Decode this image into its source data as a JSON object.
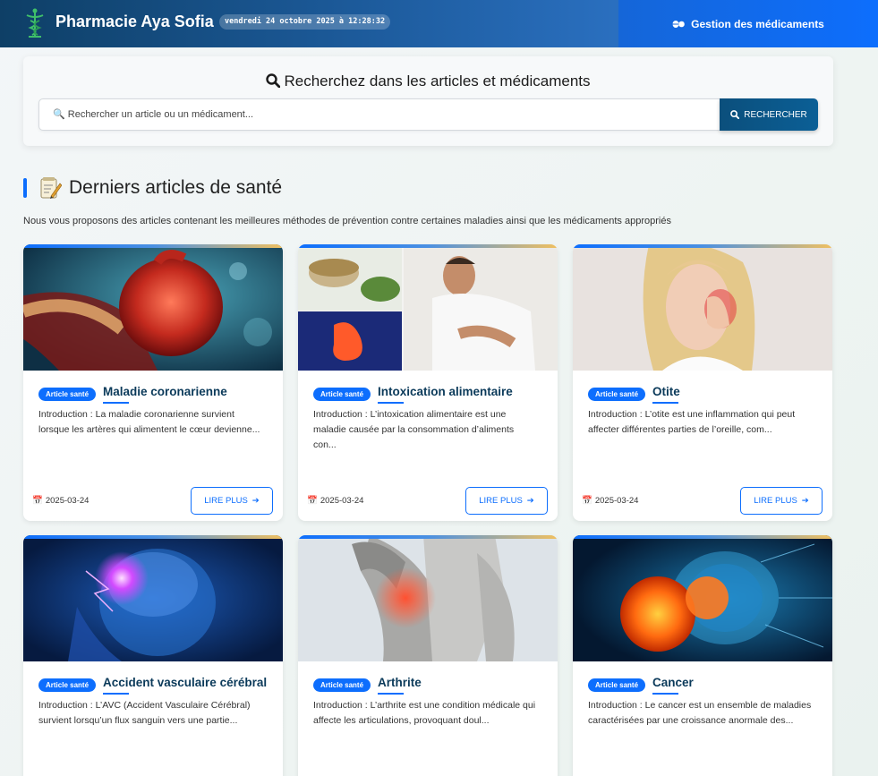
{
  "header": {
    "brand": "Pharmacie Aya Sofia",
    "datetime": "vendredi 24 octobre 2025 à 12:28:32",
    "nav_label": "Gestion des médicaments",
    "logo_icon": "caduceus-icon",
    "nav_icon": "pills-icon"
  },
  "search": {
    "title": "Recherchez dans les articles et médicaments",
    "placeholder": "🔍 Rechercher un article ou un médicament...",
    "button_label": "RECHERCHER"
  },
  "section": {
    "title": "Derniers articles de santé",
    "subtitle": "Nous vous proposons des articles contenant les meilleures méthodes de prévention contre certaines maladies ainsi que les médicaments appropriés"
  },
  "colors": {
    "primary": "#0d6efd",
    "header_dark": "#0e3f66",
    "title_text": "#0b3a5a"
  },
  "articles": [
    {
      "badge": "Article santé",
      "title": "Maladie coronarienne",
      "intro": "Introduction : La maladie coronarienne survient lorsque les artères qui alimentent le cœur devienne...",
      "date": "2025-03-24",
      "more": "LIRE PLUS",
      "image": "heart-artery-illustration"
    },
    {
      "badge": "Article santé",
      "title": "Intoxication alimentaire",
      "intro": "Introduction : L’intoxication alimentaire est une maladie causée par la consommation d’aliments con...",
      "date": "2025-03-24",
      "more": "LIRE PLUS",
      "image": "stomach-pain-collage"
    },
    {
      "badge": "Article santé",
      "title": "Otite",
      "intro": "Introduction : L’otite est une inflammation qui peut affecter différentes parties de l’oreille, com...",
      "date": "2025-03-24",
      "more": "LIRE PLUS",
      "image": "ear-pain-photo"
    },
    {
      "badge": "Article santé",
      "title": "Accident vasculaire cérébral",
      "intro": "Introduction : L’AVC (Accident Vasculaire Cérébral) survient lorsqu’un flux sanguin vers une partie...",
      "date": "",
      "more": "",
      "image": "brain-glow-illustration"
    },
    {
      "badge": "Article santé",
      "title": "Arthrite",
      "intro": "Introduction : L’arthrite est une condition médicale qui affecte les articulations, provoquant doul...",
      "date": "",
      "more": "",
      "image": "knee-pain-photo"
    },
    {
      "badge": "Article santé",
      "title": "Cancer",
      "intro": "Introduction : Le cancer est un ensemble de maladies caractérisées par une croissance anormale des...",
      "date": "",
      "more": "",
      "image": "cancer-cell-illustration"
    }
  ]
}
